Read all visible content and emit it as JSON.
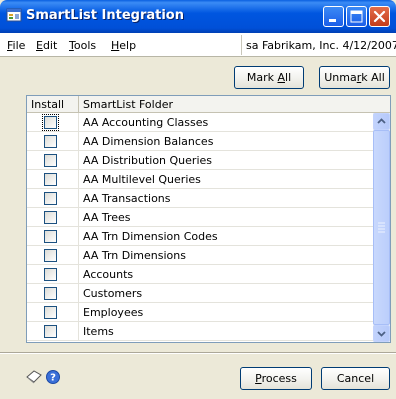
{
  "window": {
    "title": "SmartList Integration",
    "icon": "app-icon"
  },
  "menu": {
    "items": [
      {
        "label": "File",
        "mnemonic": "F",
        "rest": "ile"
      },
      {
        "label": "Edit",
        "mnemonic": "E",
        "rest": "dit"
      },
      {
        "label": "Tools",
        "mnemonic": "T",
        "rest": "ools"
      },
      {
        "label": "Help",
        "mnemonic": "H",
        "rest": "elp"
      }
    ],
    "status": "sa  Fabrikam, Inc.  4/12/2007"
  },
  "toolbar": {
    "mark_all_pre": "Mark ",
    "mark_all_mn": "A",
    "mark_all_post": "ll",
    "unmark_all_pre": "Unma",
    "unmark_all_mn": "r",
    "unmark_all_post": "k All"
  },
  "list": {
    "columns": [
      "Install",
      "SmartList Folder"
    ],
    "rows": [
      {
        "checked": false,
        "label": "AA Accounting Classes"
      },
      {
        "checked": false,
        "label": "AA Dimension Balances"
      },
      {
        "checked": false,
        "label": "AA Distribution Queries"
      },
      {
        "checked": false,
        "label": "AA Multilevel Queries"
      },
      {
        "checked": false,
        "label": "AA Transactions"
      },
      {
        "checked": false,
        "label": "AA Trees"
      },
      {
        "checked": false,
        "label": "AA Trn Dimension Codes"
      },
      {
        "checked": false,
        "label": "AA Trn Dimensions"
      },
      {
        "checked": false,
        "label": "Accounts"
      },
      {
        "checked": false,
        "label": "Customers"
      },
      {
        "checked": false,
        "label": "Employees"
      },
      {
        "checked": false,
        "label": "Items"
      }
    ]
  },
  "footer": {
    "process_mn": "P",
    "process_post": "rocess",
    "cancel_label": "Cancel",
    "icons": [
      "note-icon",
      "help-icon"
    ]
  }
}
